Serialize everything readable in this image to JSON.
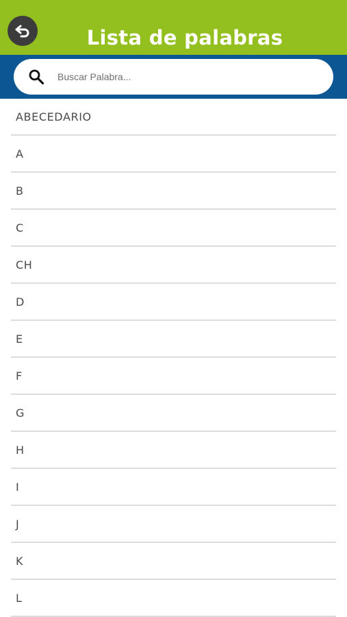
{
  "header": {
    "title": "Lista de palabras",
    "background": "#93c01f",
    "back_icon": "back-arrow-icon"
  },
  "search": {
    "placeholder": "Buscar Palabra...",
    "value": "",
    "bar_background": "#0c5694",
    "icon": "search-icon"
  },
  "list": {
    "items": [
      "ABECEDARIO",
      "A",
      "B",
      "C",
      "CH",
      "D",
      "E",
      "F",
      "G",
      "H",
      "I",
      "J",
      "K",
      "L"
    ]
  }
}
